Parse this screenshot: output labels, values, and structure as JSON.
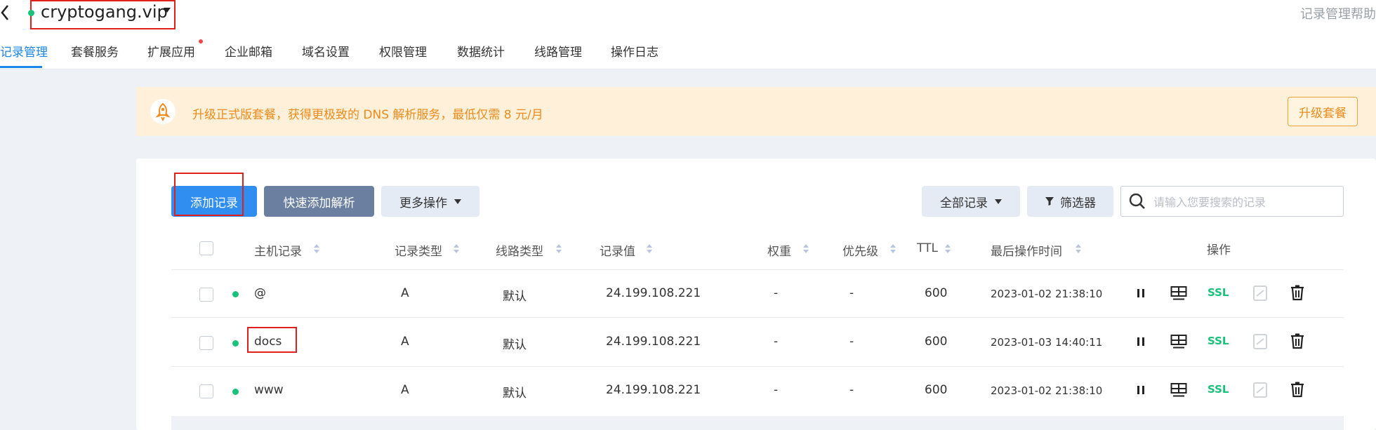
{
  "header": {
    "domain": "cryptogang.vip",
    "help_text": "记录管理帮助"
  },
  "tabs": [
    {
      "label": "记录管理",
      "active": true
    },
    {
      "label": "套餐服务"
    },
    {
      "label": "扩展应用",
      "badge": true
    },
    {
      "label": "企业邮箱"
    },
    {
      "label": "域名设置"
    },
    {
      "label": "权限管理"
    },
    {
      "label": "数据统计"
    },
    {
      "label": "线路管理"
    },
    {
      "label": "操作日志"
    }
  ],
  "banner": {
    "text": "升级正式版套餐，获得更极致的 DNS 解析服务，最低仅需 8 元/月",
    "button": "升级套餐"
  },
  "toolbar": {
    "add_record": "添加记录",
    "quick_add": "快速添加解析",
    "more_actions": "更多操作",
    "all_records": "全部记录",
    "filter": "筛选器",
    "search_placeholder": "请输入您要搜索的记录"
  },
  "table": {
    "headers": {
      "host": "主机记录",
      "type": "记录类型",
      "line": "线路类型",
      "value": "记录值",
      "weight": "权重",
      "priority": "优先级",
      "ttl": "TTL",
      "last_op": "最后操作时间",
      "actions": "操作"
    },
    "rows": [
      {
        "host": "@",
        "type": "A",
        "line": "默认",
        "value": "24.199.108.221",
        "weight": "-",
        "priority": "-",
        "ttl": "600",
        "time": "2023-01-02 21:38:10",
        "ssl": "SSL"
      },
      {
        "host": "docs",
        "type": "A",
        "line": "默认",
        "value": "24.199.108.221",
        "weight": "-",
        "priority": "-",
        "ttl": "600",
        "time": "2023-01-03 14:40:11",
        "ssl": "SSL"
      },
      {
        "host": "www",
        "type": "A",
        "line": "默认",
        "value": "24.199.108.221",
        "weight": "-",
        "priority": "-",
        "ttl": "600",
        "time": "2023-01-02 21:38:10",
        "ssl": "SSL"
      }
    ]
  },
  "colors": {
    "accent": "#1b85e8",
    "status_green": "#19c27a",
    "banner_orange": "#f08a1c",
    "highlight_red": "#e0201c"
  },
  "icons": [
    "chevron-left-icon",
    "caret-down-icon",
    "rocket-icon",
    "filter-icon",
    "search-icon",
    "pause-icon",
    "monitor-icon",
    "ssl-badge",
    "note-icon",
    "trash-icon"
  ]
}
